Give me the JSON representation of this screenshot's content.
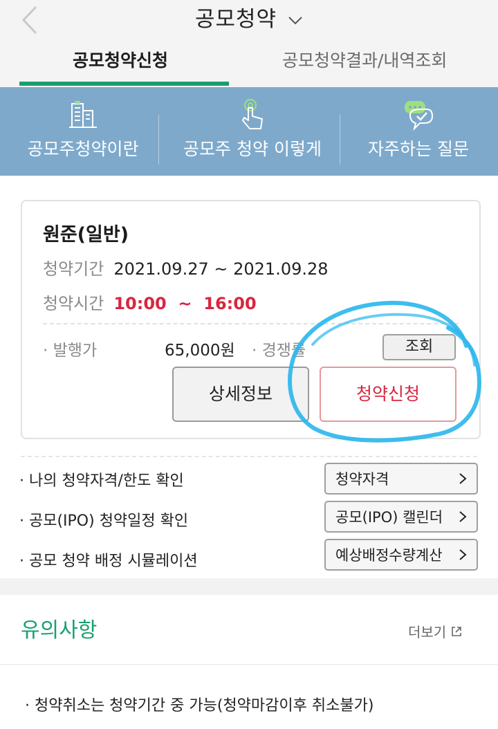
{
  "header": {
    "title": "공모청약"
  },
  "tabs": [
    {
      "label": "공모청약신청",
      "active": true
    },
    {
      "label": "공모청약결과/내역조회",
      "active": false
    }
  ],
  "banner": {
    "items": [
      {
        "label": "공모주청약이란",
        "icon": "building-icon"
      },
      {
        "label": "공모주 청약 이렇게",
        "icon": "hand-tap-icon"
      },
      {
        "label": "자주하는 질문",
        "icon": "chat-check-icon"
      }
    ]
  },
  "offering": {
    "name": "원준(일반)",
    "period_label": "청약기간",
    "period_value": "2021.09.27 ~ 2021.09.28",
    "time_label": "청약시간",
    "time_value": "10:00  ~  16:00",
    "price_label": "· 발행가",
    "price_value": "65,000원",
    "competition_label": "· 경쟁률",
    "inquiry_button": "조회",
    "detail_button": "상세정보",
    "apply_button": "청약신청"
  },
  "links": [
    {
      "text": "· 나의 청약자격/한도 확인",
      "button": "청약자격"
    },
    {
      "text": "· 공모(IPO) 청약일정 확인",
      "button": "공모(IPO) 캘린더"
    },
    {
      "text": "· 공모 청약 배정 시뮬레이션",
      "button": "예상배정수량계산"
    }
  ],
  "notice": {
    "title": "유의사항",
    "more_label": "더보기",
    "item": "· 청약취소는 청약기간 중 가능(청약마감이후 취소불가)"
  },
  "colors": {
    "accent_green": "#17a06f",
    "banner_blue": "#7ea9cb",
    "alert_red": "#d8263f",
    "highlight_cyan": "#29b6ec"
  }
}
